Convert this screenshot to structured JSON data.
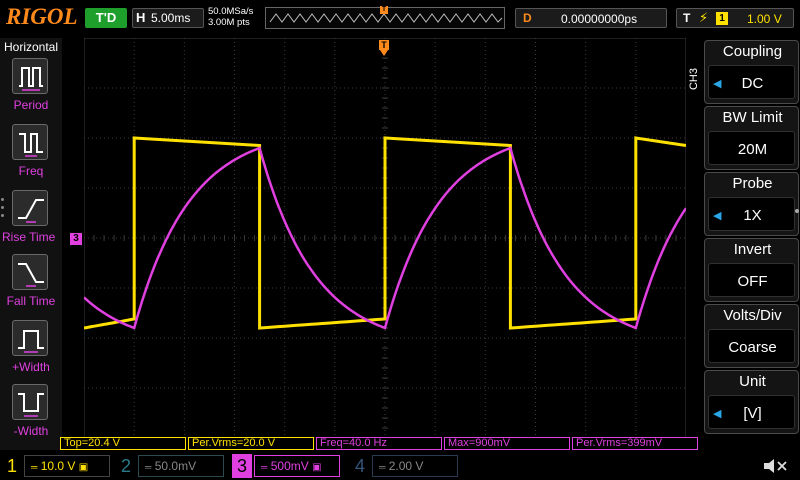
{
  "brand": "RIGOL",
  "status": {
    "run_state": "T'D"
  },
  "horizontal": {
    "letter": "H",
    "timebase": "5.00ms",
    "sample_rate": "50.0MSa/s",
    "memory_depth": "3.00M pts"
  },
  "delay": {
    "letter": "D",
    "value": "0.00000000ps"
  },
  "trigger": {
    "letter": "T",
    "edge_icon": "rising-edge-icon",
    "source": "1",
    "level": "1.00 V"
  },
  "left_menu": {
    "title": "Horizontal",
    "items": [
      {
        "label": "Period",
        "icon": "period-icon"
      },
      {
        "label": "Freq",
        "icon": "freq-icon"
      },
      {
        "label": "Rise Time",
        "icon": "rise-time-icon"
      },
      {
        "label": "Fall Time",
        "icon": "fall-time-icon"
      },
      {
        "label": "+Width",
        "icon": "positive-width-icon"
      },
      {
        "label": "-Width",
        "icon": "negative-width-icon"
      }
    ]
  },
  "right_menu": {
    "channel_label": "CH3",
    "items": [
      {
        "title": "Coupling",
        "value": "DC",
        "has_arrow": true
      },
      {
        "title": "BW Limit",
        "value": "20M",
        "has_arrow": false
      },
      {
        "title": "Probe",
        "value": "1X",
        "has_arrow": true
      },
      {
        "title": "Invert",
        "value": "OFF",
        "has_arrow": false
      },
      {
        "title": "Volts/Div",
        "value": "Coarse",
        "has_arrow": false
      },
      {
        "title": "Unit",
        "value": "[V]",
        "has_arrow": true
      }
    ]
  },
  "measurements": [
    {
      "text": "Top=20.4 V",
      "color": "#ffe100"
    },
    {
      "text": "Per.Vrms=20.0 V",
      "color": "#ffe100"
    },
    {
      "text": "Freq=40.0 Hz",
      "color": "#e040e0"
    },
    {
      "text": "Max=900mV",
      "color": "#e040e0"
    },
    {
      "text": "Per.Vrms=399mV",
      "color": "#e040e0"
    }
  ],
  "channels": [
    {
      "number": "1",
      "scale": "10.0 V",
      "color": "#ffe100",
      "active": true
    },
    {
      "number": "2",
      "scale": "50.0mV",
      "color": "#2a7a8a",
      "active": false
    },
    {
      "number": "3",
      "scale": "500mV",
      "color": "#e040e0",
      "active": true
    },
    {
      "number": "4",
      "scale": "2.00 V",
      "color": "#35557a",
      "active": false
    }
  ],
  "markers": {
    "ch3_ground": "3",
    "trigger_level": "T"
  },
  "colors": {
    "ch1": "#ffe100",
    "ch3": "#e040e0",
    "accent": "#ff8a1c",
    "grid": "#3b3b3b",
    "menu_arrow": "#2aa5e6"
  },
  "chart_data": {
    "type": "line",
    "x_unit": "div",
    "xlim": [
      -6,
      6
    ],
    "ylim": [
      -4,
      4
    ],
    "series": [
      {
        "name": "CH1 square",
        "color": "#ffe100",
        "high": 2.0,
        "low": -1.8,
        "period_div": 5.0,
        "rising_edges_div": [
          -5.0,
          0.0,
          5.0
        ],
        "falling_edges_div": [
          -2.5,
          2.5
        ]
      },
      {
        "name": "CH3 RC response",
        "color": "#e040e0",
        "high": 1.8,
        "low": -1.8,
        "period_div": 5.0,
        "peaks_div": [
          -2.5,
          2.5
        ],
        "troughs_div": [
          -5.0,
          0.0,
          5.0
        ]
      }
    ]
  }
}
